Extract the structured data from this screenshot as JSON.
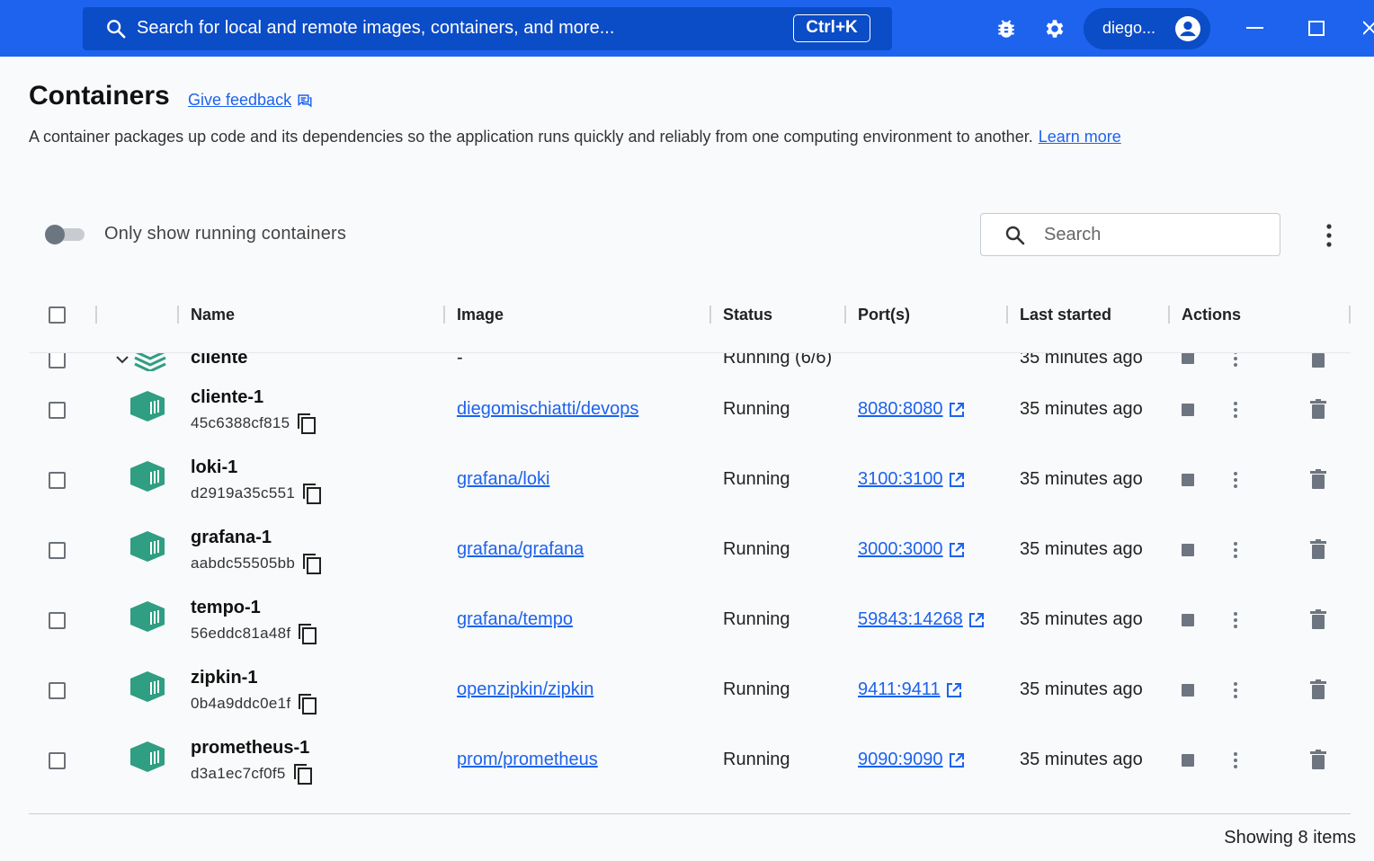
{
  "topbar": {
    "search_placeholder": "Search for local and remote images, containers, and more...",
    "shortcut": "Ctrl+K",
    "user": "diego..."
  },
  "header": {
    "title": "Containers",
    "feedback": "Give feedback",
    "description": "A container packages up code and its dependencies so the application runs quickly and reliably from one computing environment to another.",
    "learn_more": "Learn more"
  },
  "toolbar": {
    "toggle_label": "Only show running containers",
    "search_placeholder": "Search"
  },
  "table": {
    "columns": [
      "Name",
      "Image",
      "Status",
      "Port(s)",
      "Last started",
      "Actions"
    ],
    "group": {
      "name": "cliente",
      "image": "-",
      "status": "Running (6/6)",
      "last_started": "35 minutes ago"
    },
    "rows": [
      {
        "name": "cliente-1",
        "id": "45c6388cf815",
        "image": "diegomischiatti/devops",
        "status": "Running",
        "port": "8080:8080",
        "last_started": "35 minutes ago"
      },
      {
        "name": "loki-1",
        "id": "d2919a35c551",
        "image": "grafana/loki",
        "status": "Running",
        "port": "3100:3100",
        "last_started": "35 minutes ago"
      },
      {
        "name": "grafana-1",
        "id": "aabdc55505bb",
        "image": "grafana/grafana",
        "status": "Running",
        "port": "3000:3000",
        "last_started": "35 minutes ago"
      },
      {
        "name": "tempo-1",
        "id": "56eddc81a48f",
        "image": "grafana/tempo",
        "status": "Running",
        "port": "59843:14268",
        "last_started": "35 minutes ago"
      },
      {
        "name": "zipkin-1",
        "id": "0b4a9ddc0e1f",
        "image": "openzipkin/zipkin",
        "status": "Running",
        "port": "9411:9411",
        "last_started": "35 minutes ago"
      },
      {
        "name": "prometheus-1",
        "id": "d3a1ec7cf0f5",
        "image": "prom/prometheus",
        "status": "Running",
        "port": "9090:9090",
        "last_started": "35 minutes ago"
      }
    ]
  },
  "footer": {
    "count": "Showing 8 items"
  },
  "colors": {
    "brand": "#1d63ed",
    "brand_dark": "#0b4cc7",
    "container_icon": "#2f9e82"
  }
}
